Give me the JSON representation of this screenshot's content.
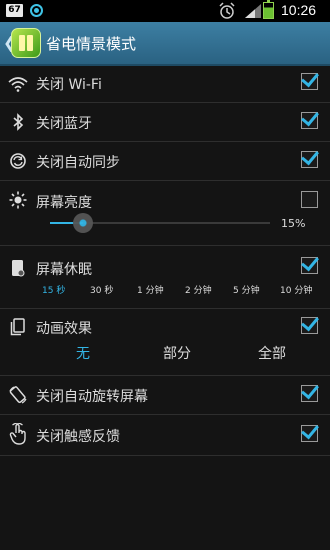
{
  "status_bar": {
    "badge": "67",
    "time": "10:26"
  },
  "header": {
    "title": "省电情景模式"
  },
  "rows": {
    "wifi": {
      "label": "关闭 Wi-Fi",
      "checked": true
    },
    "bluetooth": {
      "label": "关闭蓝牙",
      "checked": true
    },
    "sync": {
      "label": "关闭自动同步",
      "checked": true
    },
    "brightness": {
      "label": "屏幕亮度",
      "checked": false,
      "value_text": "15%",
      "level": 0.15
    },
    "sleep": {
      "label": "屏幕休眠",
      "checked": true,
      "options": [
        "15 秒",
        "30 秒",
        "1 分钟",
        "2 分钟",
        "5 分钟",
        "10 分钟"
      ],
      "selected": "15 秒"
    },
    "animation": {
      "label": "动画效果",
      "checked": true,
      "options": [
        "无",
        "部分",
        "全部"
      ],
      "selected": "无"
    },
    "rotate": {
      "label": "关闭自动旋转屏幕",
      "checked": true
    },
    "haptic": {
      "label": "关闭触感反馈",
      "checked": true
    }
  },
  "colors": {
    "accent": "#33b5e5",
    "actionbar": "#2f6d8f",
    "background": "#141414"
  },
  "icons": {
    "wifi": "wifi-icon",
    "bluetooth": "bluetooth-icon",
    "sync": "sync-icon",
    "brightness": "brightness-icon",
    "sleep": "screen-sleep-icon",
    "animation": "animation-icon",
    "rotate": "rotate-icon",
    "haptic": "touch-icon"
  }
}
